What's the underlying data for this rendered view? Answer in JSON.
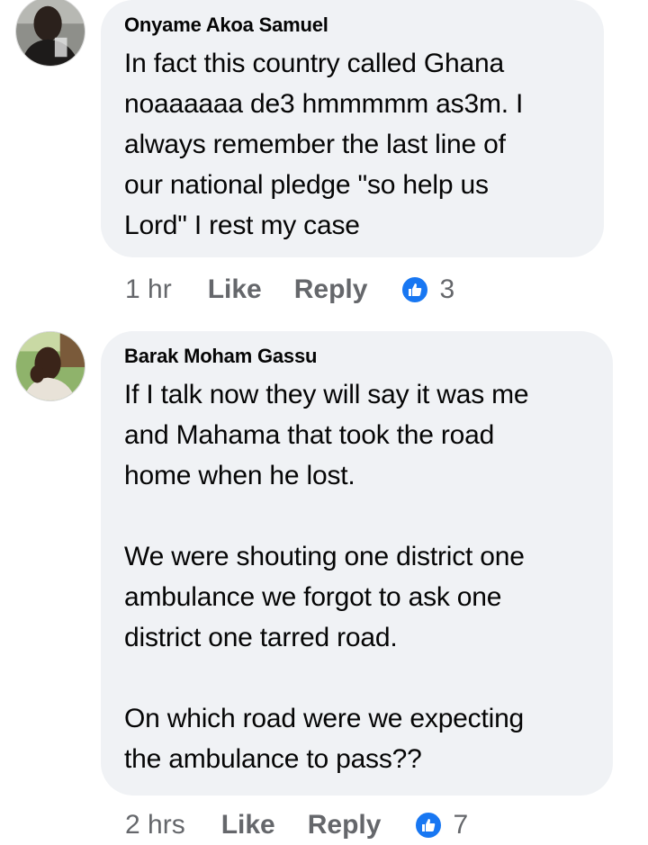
{
  "comments": [
    {
      "author": "Onyame Akoa Samuel",
      "text": "In fact this country called Ghana\nnoaaaaaa de3 hmmmmm as3m. I\nalways remember the last line of\nour national pledge \"so help us\nLord\" I rest my case",
      "time": "1 hr",
      "like_label": "Like",
      "reply_label": "Reply",
      "reaction_icon": "thumbs-up-icon",
      "reaction_count": "3"
    },
    {
      "author": "Barak Moham Gassu",
      "text": "If I talk now they will say it was me\nand Mahama that took the road\nhome when he lost.\n\nWe were shouting one district one\nambulance we forgot to ask one\ndistrict one tarred road.\n\nOn which road were we expecting\nthe ambulance to pass??",
      "time": "2 hrs",
      "like_label": "Like",
      "reply_label": "Reply",
      "reaction_icon": "thumbs-up-icon",
      "reaction_count": "7"
    }
  ],
  "colors": {
    "bubble_bg": "#f0f2f5",
    "meta_text": "#65676b",
    "like_blue": "#1877f2"
  }
}
